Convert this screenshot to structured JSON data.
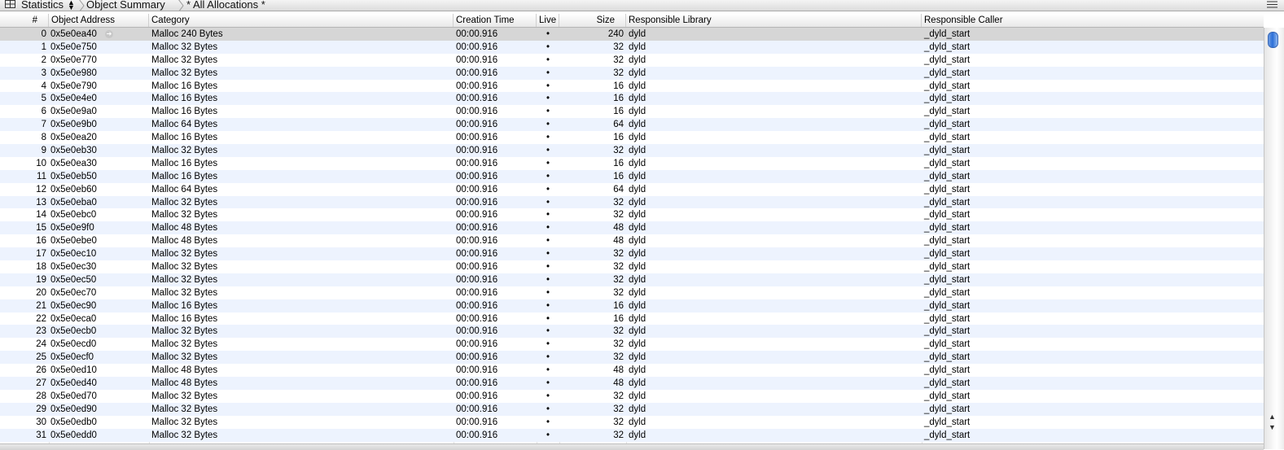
{
  "breadcrumb": {
    "item1": "Statistics",
    "item2": "Object Summary",
    "item3": "* All Allocations *"
  },
  "columns": {
    "num": "#",
    "address": "Object Address",
    "category": "Category",
    "time": "Creation Time",
    "live": "Live",
    "size": "Size",
    "library": "Responsible Library",
    "caller": "Responsible Caller"
  },
  "rows": [
    {
      "num": "0",
      "address": "0x5e0ea40",
      "category": "Malloc 240 Bytes",
      "time": "00:00.916",
      "live": "•",
      "size": "240",
      "library": "dyld",
      "caller": "_dyld_start"
    },
    {
      "num": "1",
      "address": "0x5e0e750",
      "category": "Malloc 32 Bytes",
      "time": "00:00.916",
      "live": "•",
      "size": "32",
      "library": "dyld",
      "caller": "_dyld_start"
    },
    {
      "num": "2",
      "address": "0x5e0e770",
      "category": "Malloc 32 Bytes",
      "time": "00:00.916",
      "live": "•",
      "size": "32",
      "library": "dyld",
      "caller": "_dyld_start"
    },
    {
      "num": "3",
      "address": "0x5e0e980",
      "category": "Malloc 32 Bytes",
      "time": "00:00.916",
      "live": "•",
      "size": "32",
      "library": "dyld",
      "caller": "_dyld_start"
    },
    {
      "num": "4",
      "address": "0x5e0e790",
      "category": "Malloc 16 Bytes",
      "time": "00:00.916",
      "live": "•",
      "size": "16",
      "library": "dyld",
      "caller": "_dyld_start"
    },
    {
      "num": "5",
      "address": "0x5e0e4e0",
      "category": "Malloc 16 Bytes",
      "time": "00:00.916",
      "live": "•",
      "size": "16",
      "library": "dyld",
      "caller": "_dyld_start"
    },
    {
      "num": "6",
      "address": "0x5e0e9a0",
      "category": "Malloc 16 Bytes",
      "time": "00:00.916",
      "live": "•",
      "size": "16",
      "library": "dyld",
      "caller": "_dyld_start"
    },
    {
      "num": "7",
      "address": "0x5e0e9b0",
      "category": "Malloc 64 Bytes",
      "time": "00:00.916",
      "live": "•",
      "size": "64",
      "library": "dyld",
      "caller": "_dyld_start"
    },
    {
      "num": "8",
      "address": "0x5e0ea20",
      "category": "Malloc 16 Bytes",
      "time": "00:00.916",
      "live": "•",
      "size": "16",
      "library": "dyld",
      "caller": "_dyld_start"
    },
    {
      "num": "9",
      "address": "0x5e0eb30",
      "category": "Malloc 32 Bytes",
      "time": "00:00.916",
      "live": "•",
      "size": "32",
      "library": "dyld",
      "caller": "_dyld_start"
    },
    {
      "num": "10",
      "address": "0x5e0ea30",
      "category": "Malloc 16 Bytes",
      "time": "00:00.916",
      "live": "•",
      "size": "16",
      "library": "dyld",
      "caller": "_dyld_start"
    },
    {
      "num": "11",
      "address": "0x5e0eb50",
      "category": "Malloc 16 Bytes",
      "time": "00:00.916",
      "live": "•",
      "size": "16",
      "library": "dyld",
      "caller": "_dyld_start"
    },
    {
      "num": "12",
      "address": "0x5e0eb60",
      "category": "Malloc 64 Bytes",
      "time": "00:00.916",
      "live": "•",
      "size": "64",
      "library": "dyld",
      "caller": "_dyld_start"
    },
    {
      "num": "13",
      "address": "0x5e0eba0",
      "category": "Malloc 32 Bytes",
      "time": "00:00.916",
      "live": "•",
      "size": "32",
      "library": "dyld",
      "caller": "_dyld_start"
    },
    {
      "num": "14",
      "address": "0x5e0ebc0",
      "category": "Malloc 32 Bytes",
      "time": "00:00.916",
      "live": "•",
      "size": "32",
      "library": "dyld",
      "caller": "_dyld_start"
    },
    {
      "num": "15",
      "address": "0x5e0e9f0",
      "category": "Malloc 48 Bytes",
      "time": "00:00.916",
      "live": "•",
      "size": "48",
      "library": "dyld",
      "caller": "_dyld_start"
    },
    {
      "num": "16",
      "address": "0x5e0ebe0",
      "category": "Malloc 48 Bytes",
      "time": "00:00.916",
      "live": "•",
      "size": "48",
      "library": "dyld",
      "caller": "_dyld_start"
    },
    {
      "num": "17",
      "address": "0x5e0ec10",
      "category": "Malloc 32 Bytes",
      "time": "00:00.916",
      "live": "•",
      "size": "32",
      "library": "dyld",
      "caller": "_dyld_start"
    },
    {
      "num": "18",
      "address": "0x5e0ec30",
      "category": "Malloc 32 Bytes",
      "time": "00:00.916",
      "live": "•",
      "size": "32",
      "library": "dyld",
      "caller": "_dyld_start"
    },
    {
      "num": "19",
      "address": "0x5e0ec50",
      "category": "Malloc 32 Bytes",
      "time": "00:00.916",
      "live": "•",
      "size": "32",
      "library": "dyld",
      "caller": "_dyld_start"
    },
    {
      "num": "20",
      "address": "0x5e0ec70",
      "category": "Malloc 32 Bytes",
      "time": "00:00.916",
      "live": "•",
      "size": "32",
      "library": "dyld",
      "caller": "_dyld_start"
    },
    {
      "num": "21",
      "address": "0x5e0ec90",
      "category": "Malloc 16 Bytes",
      "time": "00:00.916",
      "live": "•",
      "size": "16",
      "library": "dyld",
      "caller": "_dyld_start"
    },
    {
      "num": "22",
      "address": "0x5e0eca0",
      "category": "Malloc 16 Bytes",
      "time": "00:00.916",
      "live": "•",
      "size": "16",
      "library": "dyld",
      "caller": "_dyld_start"
    },
    {
      "num": "23",
      "address": "0x5e0ecb0",
      "category": "Malloc 32 Bytes",
      "time": "00:00.916",
      "live": "•",
      "size": "32",
      "library": "dyld",
      "caller": "_dyld_start"
    },
    {
      "num": "24",
      "address": "0x5e0ecd0",
      "category": "Malloc 32 Bytes",
      "time": "00:00.916",
      "live": "•",
      "size": "32",
      "library": "dyld",
      "caller": "_dyld_start"
    },
    {
      "num": "25",
      "address": "0x5e0ecf0",
      "category": "Malloc 32 Bytes",
      "time": "00:00.916",
      "live": "•",
      "size": "32",
      "library": "dyld",
      "caller": "_dyld_start"
    },
    {
      "num": "26",
      "address": "0x5e0ed10",
      "category": "Malloc 48 Bytes",
      "time": "00:00.916",
      "live": "•",
      "size": "48",
      "library": "dyld",
      "caller": "_dyld_start"
    },
    {
      "num": "27",
      "address": "0x5e0ed40",
      "category": "Malloc 48 Bytes",
      "time": "00:00.916",
      "live": "•",
      "size": "48",
      "library": "dyld",
      "caller": "_dyld_start"
    },
    {
      "num": "28",
      "address": "0x5e0ed70",
      "category": "Malloc 32 Bytes",
      "time": "00:00.916",
      "live": "•",
      "size": "32",
      "library": "dyld",
      "caller": "_dyld_start"
    },
    {
      "num": "29",
      "address": "0x5e0ed90",
      "category": "Malloc 32 Bytes",
      "time": "00:00.916",
      "live": "•",
      "size": "32",
      "library": "dyld",
      "caller": "_dyld_start"
    },
    {
      "num": "30",
      "address": "0x5e0edb0",
      "category": "Malloc 32 Bytes",
      "time": "00:00.916",
      "live": "•",
      "size": "32",
      "library": "dyld",
      "caller": "_dyld_start"
    },
    {
      "num": "31",
      "address": "0x5e0edd0",
      "category": "Malloc 32 Bytes",
      "time": "00:00.916",
      "live": "•",
      "size": "32",
      "library": "dyld",
      "caller": "_dyld_start"
    }
  ],
  "selected_row": 0,
  "icons": {
    "grid": "grid-icon",
    "updown": "updown-arrows-icon",
    "menu": "menu-icon",
    "detail": "detail-arrow-icon"
  },
  "colors": {
    "selected_row": "#d6d6d6",
    "alt_row": "#edf3fe",
    "scroll_thumb": "#2c6fd8"
  }
}
